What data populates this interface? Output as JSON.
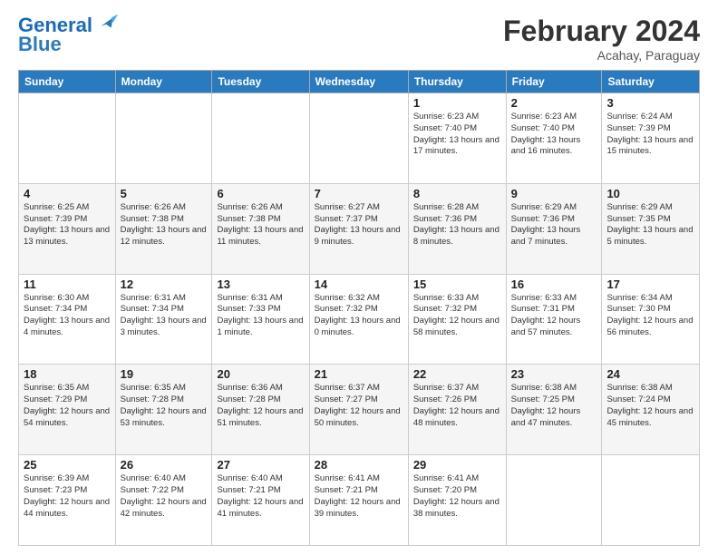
{
  "logo": {
    "line1": "General",
    "line2": "Blue"
  },
  "title": "February 2024",
  "subtitle": "Acahay, Paraguay",
  "weekdays": [
    "Sunday",
    "Monday",
    "Tuesday",
    "Wednesday",
    "Thursday",
    "Friday",
    "Saturday"
  ],
  "weeks": [
    [
      {
        "day": "",
        "info": ""
      },
      {
        "day": "",
        "info": ""
      },
      {
        "day": "",
        "info": ""
      },
      {
        "day": "",
        "info": ""
      },
      {
        "day": "1",
        "info": "Sunrise: 6:23 AM\nSunset: 7:40 PM\nDaylight: 13 hours and 17 minutes."
      },
      {
        "day": "2",
        "info": "Sunrise: 6:23 AM\nSunset: 7:40 PM\nDaylight: 13 hours and 16 minutes."
      },
      {
        "day": "3",
        "info": "Sunrise: 6:24 AM\nSunset: 7:39 PM\nDaylight: 13 hours and 15 minutes."
      }
    ],
    [
      {
        "day": "4",
        "info": "Sunrise: 6:25 AM\nSunset: 7:39 PM\nDaylight: 13 hours and 13 minutes."
      },
      {
        "day": "5",
        "info": "Sunrise: 6:26 AM\nSunset: 7:38 PM\nDaylight: 13 hours and 12 minutes."
      },
      {
        "day": "6",
        "info": "Sunrise: 6:26 AM\nSunset: 7:38 PM\nDaylight: 13 hours and 11 minutes."
      },
      {
        "day": "7",
        "info": "Sunrise: 6:27 AM\nSunset: 7:37 PM\nDaylight: 13 hours and 9 minutes."
      },
      {
        "day": "8",
        "info": "Sunrise: 6:28 AM\nSunset: 7:36 PM\nDaylight: 13 hours and 8 minutes."
      },
      {
        "day": "9",
        "info": "Sunrise: 6:29 AM\nSunset: 7:36 PM\nDaylight: 13 hours and 7 minutes."
      },
      {
        "day": "10",
        "info": "Sunrise: 6:29 AM\nSunset: 7:35 PM\nDaylight: 13 hours and 5 minutes."
      }
    ],
    [
      {
        "day": "11",
        "info": "Sunrise: 6:30 AM\nSunset: 7:34 PM\nDaylight: 13 hours and 4 minutes."
      },
      {
        "day": "12",
        "info": "Sunrise: 6:31 AM\nSunset: 7:34 PM\nDaylight: 13 hours and 3 minutes."
      },
      {
        "day": "13",
        "info": "Sunrise: 6:31 AM\nSunset: 7:33 PM\nDaylight: 13 hours and 1 minute."
      },
      {
        "day": "14",
        "info": "Sunrise: 6:32 AM\nSunset: 7:32 PM\nDaylight: 13 hours and 0 minutes."
      },
      {
        "day": "15",
        "info": "Sunrise: 6:33 AM\nSunset: 7:32 PM\nDaylight: 12 hours and 58 minutes."
      },
      {
        "day": "16",
        "info": "Sunrise: 6:33 AM\nSunset: 7:31 PM\nDaylight: 12 hours and 57 minutes."
      },
      {
        "day": "17",
        "info": "Sunrise: 6:34 AM\nSunset: 7:30 PM\nDaylight: 12 hours and 56 minutes."
      }
    ],
    [
      {
        "day": "18",
        "info": "Sunrise: 6:35 AM\nSunset: 7:29 PM\nDaylight: 12 hours and 54 minutes."
      },
      {
        "day": "19",
        "info": "Sunrise: 6:35 AM\nSunset: 7:28 PM\nDaylight: 12 hours and 53 minutes."
      },
      {
        "day": "20",
        "info": "Sunrise: 6:36 AM\nSunset: 7:28 PM\nDaylight: 12 hours and 51 minutes."
      },
      {
        "day": "21",
        "info": "Sunrise: 6:37 AM\nSunset: 7:27 PM\nDaylight: 12 hours and 50 minutes."
      },
      {
        "day": "22",
        "info": "Sunrise: 6:37 AM\nSunset: 7:26 PM\nDaylight: 12 hours and 48 minutes."
      },
      {
        "day": "23",
        "info": "Sunrise: 6:38 AM\nSunset: 7:25 PM\nDaylight: 12 hours and 47 minutes."
      },
      {
        "day": "24",
        "info": "Sunrise: 6:38 AM\nSunset: 7:24 PM\nDaylight: 12 hours and 45 minutes."
      }
    ],
    [
      {
        "day": "25",
        "info": "Sunrise: 6:39 AM\nSunset: 7:23 PM\nDaylight: 12 hours and 44 minutes."
      },
      {
        "day": "26",
        "info": "Sunrise: 6:40 AM\nSunset: 7:22 PM\nDaylight: 12 hours and 42 minutes."
      },
      {
        "day": "27",
        "info": "Sunrise: 6:40 AM\nSunset: 7:21 PM\nDaylight: 12 hours and 41 minutes."
      },
      {
        "day": "28",
        "info": "Sunrise: 6:41 AM\nSunset: 7:21 PM\nDaylight: 12 hours and 39 minutes."
      },
      {
        "day": "29",
        "info": "Sunrise: 6:41 AM\nSunset: 7:20 PM\nDaylight: 12 hours and 38 minutes."
      },
      {
        "day": "",
        "info": ""
      },
      {
        "day": "",
        "info": ""
      }
    ]
  ]
}
